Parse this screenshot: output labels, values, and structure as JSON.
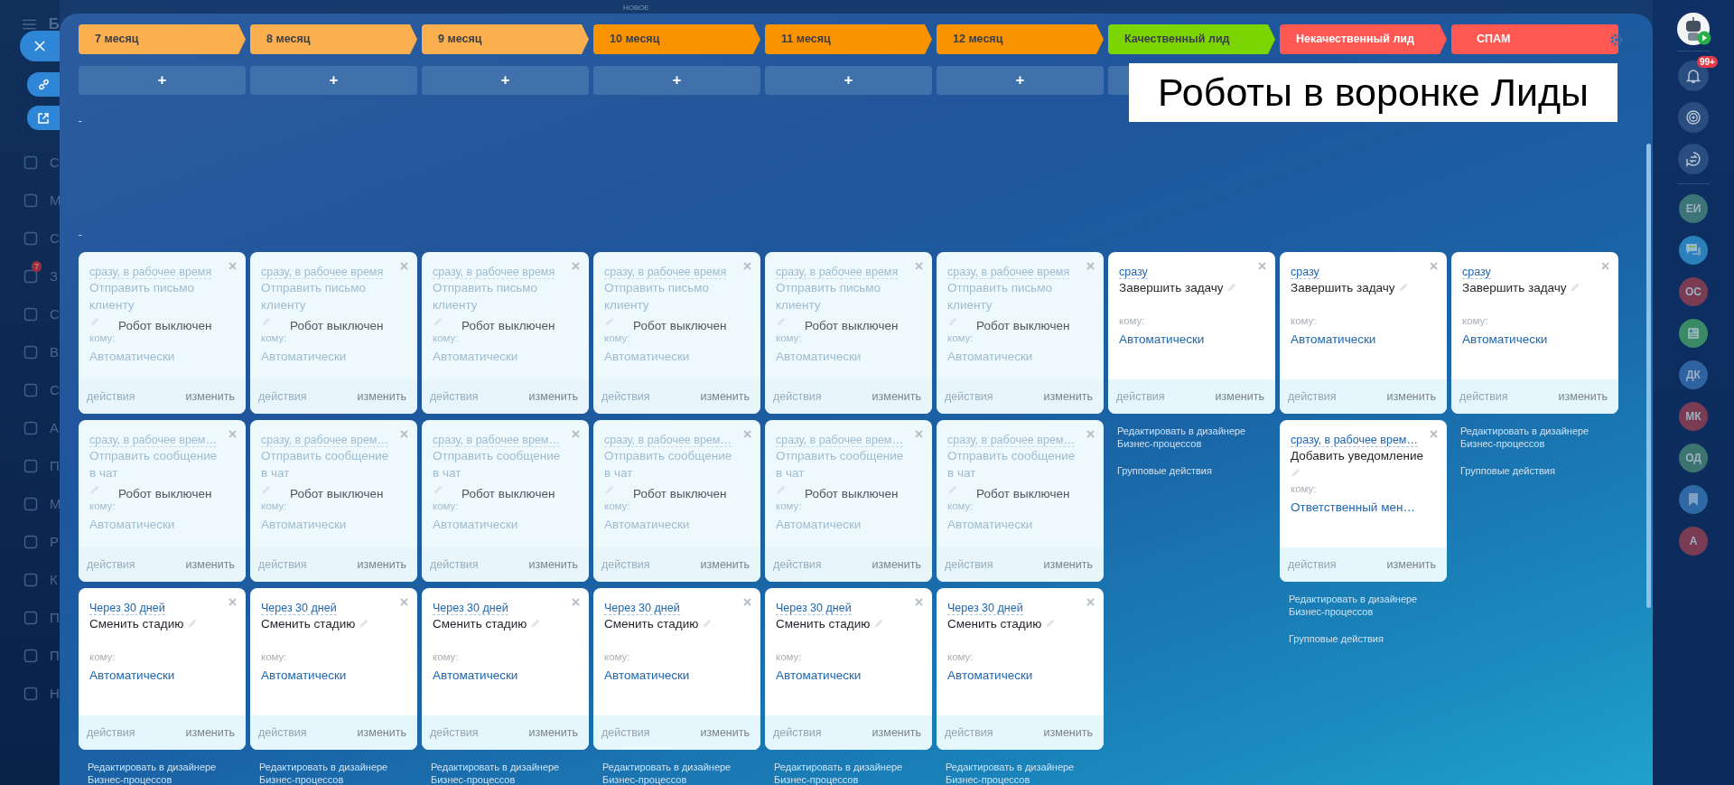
{
  "top_bar": {
    "label": "НОВОЕ"
  },
  "left_nav": {
    "title": "Б",
    "items": [
      {
        "label": "С"
      },
      {
        "label": "М"
      },
      {
        "label": "С"
      },
      {
        "label": "З",
        "badge": "7"
      },
      {
        "label": "С"
      },
      {
        "label": "В"
      },
      {
        "label": "С"
      },
      {
        "label": "А"
      },
      {
        "label": "П"
      },
      {
        "label": "М"
      },
      {
        "label": "Р"
      },
      {
        "label": "К"
      },
      {
        "label": "П"
      },
      {
        "label": "П"
      },
      {
        "label": "Н"
      }
    ]
  },
  "floating_buttons": [
    {
      "kind": "close"
    },
    {
      "kind": "link"
    },
    {
      "kind": "external"
    }
  ],
  "stages": [
    {
      "label": "7 месяц",
      "color": "#fcaf4f"
    },
    {
      "label": "8 месяц",
      "color": "#fcaf4f"
    },
    {
      "label": "9 месяц",
      "color": "#fcaf4f"
    },
    {
      "label": "10 месяц",
      "color": "#fa9300"
    },
    {
      "label": "11 месяц",
      "color": "#fa9300"
    },
    {
      "label": "12 месяц",
      "color": "#fa9300"
    },
    {
      "label": "Качественный лид",
      "color": "#7bd500"
    },
    {
      "label": "Некачественный лид",
      "color": "#ff5752"
    },
    {
      "label": "СПАМ",
      "color": "#ff5752"
    }
  ],
  "add_buttons": [
    {
      "label": "+"
    },
    {
      "label": "+"
    },
    {
      "label": "+"
    },
    {
      "label": "+"
    },
    {
      "label": "+"
    },
    {
      "label": "+"
    },
    {
      "kind": "covered"
    }
  ],
  "dashes": [
    "-",
    "-"
  ],
  "columns": [
    {
      "cells": [
        {
          "kind": "robot",
          "trigger": "сразу, в рабочее время",
          "action": "Отправить письмо клиенту",
          "recipient_label": "кому:",
          "recipient": "Автоматически",
          "disabled": true,
          "overlay": "Робот выключен",
          "footer_left": "действия",
          "footer_right": "изменить"
        },
        {
          "kind": "robot",
          "trigger": "сразу, в рабочее врем…",
          "action": "Отправить сообщение в чат",
          "recipient_label": "кому:",
          "recipient": "Автоматически",
          "disabled": true,
          "overlay": "Робот выключен",
          "footer_left": "действия",
          "footer_right": "изменить"
        },
        {
          "kind": "robot",
          "trigger": "Через 30 дней",
          "action": "Сменить стадию",
          "recipient_label": "кому:",
          "recipient": "Автоматически",
          "disabled": false,
          "footer_left": "действия",
          "footer_right": "изменить"
        },
        {
          "kind": "links",
          "edit": "Редактировать в дизайнере Бизнес-процессов"
        }
      ]
    },
    {
      "cells": [
        {
          "kind": "robot",
          "trigger": "сразу, в рабочее время",
          "action": "Отправить письмо клиенту",
          "recipient_label": "кому:",
          "recipient": "Автоматически",
          "disabled": true,
          "overlay": "Робот выключен",
          "footer_left": "действия",
          "footer_right": "изменить"
        },
        {
          "kind": "robot",
          "trigger": "сразу, в рабочее врем…",
          "action": "Отправить сообщение в чат",
          "recipient_label": "кому:",
          "recipient": "Автоматически",
          "disabled": true,
          "overlay": "Робот выключен",
          "footer_left": "действия",
          "footer_right": "изменить"
        },
        {
          "kind": "robot",
          "trigger": "Через 30 дней",
          "action": "Сменить стадию",
          "recipient_label": "кому:",
          "recipient": "Автоматически",
          "disabled": false,
          "footer_left": "действия",
          "footer_right": "изменить"
        },
        {
          "kind": "links",
          "edit": "Редактировать в дизайнере Бизнес-процессов"
        }
      ]
    },
    {
      "cells": [
        {
          "kind": "robot",
          "trigger": "сразу, в рабочее время",
          "action": "Отправить письмо клиенту",
          "recipient_label": "кому:",
          "recipient": "Автоматически",
          "disabled": true,
          "overlay": "Робот выключен",
          "footer_left": "действия",
          "footer_right": "изменить"
        },
        {
          "kind": "robot",
          "trigger": "сразу, в рабочее врем…",
          "action": "Отправить сообщение в чат",
          "recipient_label": "кому:",
          "recipient": "Автоматически",
          "disabled": true,
          "overlay": "Робот выключен",
          "footer_left": "действия",
          "footer_right": "изменить"
        },
        {
          "kind": "robot",
          "trigger": "Через 30 дней",
          "action": "Сменить стадию",
          "recipient_label": "кому:",
          "recipient": "Автоматически",
          "disabled": false,
          "footer_left": "действия",
          "footer_right": "изменить"
        },
        {
          "kind": "links",
          "edit": "Редактировать в дизайнере Бизнес-процессов"
        }
      ]
    },
    {
      "cells": [
        {
          "kind": "robot",
          "trigger": "сразу, в рабочее время",
          "action": "Отправить письмо клиенту",
          "recipient_label": "кому:",
          "recipient": "Автоматически",
          "disabled": true,
          "overlay": "Робот выключен",
          "footer_left": "действия",
          "footer_right": "изменить"
        },
        {
          "kind": "robot",
          "trigger": "сразу, в рабочее врем…",
          "action": "Отправить сообщение в чат",
          "recipient_label": "кому:",
          "recipient": "Автоматически",
          "disabled": true,
          "overlay": "Робот выключен",
          "footer_left": "действия",
          "footer_right": "изменить"
        },
        {
          "kind": "robot",
          "trigger": "Через 30 дней",
          "action": "Сменить стадию",
          "recipient_label": "кому:",
          "recipient": "Автоматически",
          "disabled": false,
          "footer_left": "действия",
          "footer_right": "изменить"
        },
        {
          "kind": "links",
          "edit": "Редактировать в дизайнере Бизнес-процессов"
        }
      ]
    },
    {
      "cells": [
        {
          "kind": "robot",
          "trigger": "сразу, в рабочее время",
          "action": "Отправить письмо клиенту",
          "recipient_label": "кому:",
          "recipient": "Автоматически",
          "disabled": true,
          "overlay": "Робот выключен",
          "footer_left": "действия",
          "footer_right": "изменить"
        },
        {
          "kind": "robot",
          "trigger": "сразу, в рабочее врем…",
          "action": "Отправить сообщение в чат",
          "recipient_label": "кому:",
          "recipient": "Автоматически",
          "disabled": true,
          "overlay": "Робот выключен",
          "footer_left": "действия",
          "footer_right": "изменить"
        },
        {
          "kind": "robot",
          "trigger": "Через 30 дней",
          "action": "Сменить стадию",
          "recipient_label": "кому:",
          "recipient": "Автоматически",
          "disabled": false,
          "footer_left": "действия",
          "footer_right": "изменить"
        },
        {
          "kind": "links",
          "edit": "Редактировать в дизайнере Бизнес-процессов"
        }
      ]
    },
    {
      "cells": [
        {
          "kind": "robot",
          "trigger": "сразу, в рабочее время",
          "action": "Отправить письмо клиенту",
          "recipient_label": "кому:",
          "recipient": "Автоматически",
          "disabled": true,
          "overlay": "Робот выключен",
          "footer_left": "действия",
          "footer_right": "изменить"
        },
        {
          "kind": "robot",
          "trigger": "сразу, в рабочее врем…",
          "action": "Отправить сообщение в чат",
          "recipient_label": "кому:",
          "recipient": "Автоматически",
          "disabled": true,
          "overlay": "Робот выключен",
          "footer_left": "действия",
          "footer_right": "изменить"
        },
        {
          "kind": "robot",
          "trigger": "Через 30 дней",
          "action": "Сменить стадию",
          "recipient_label": "кому:",
          "recipient": "Автоматически",
          "disabled": false,
          "footer_left": "действия",
          "footer_right": "изменить"
        },
        {
          "kind": "links",
          "edit": "Редактировать в дизайнере Бизнес-процессов"
        }
      ]
    },
    {
      "cells": [
        {
          "kind": "robot",
          "trigger": "сразу",
          "action": "Завершить задачу",
          "recipient_label": "кому:",
          "recipient": "Автоматически",
          "disabled": false,
          "footer_left": "действия",
          "footer_right": "изменить"
        },
        {
          "kind": "links",
          "edit": "Редактировать в дизайнере Бизнес-процессов",
          "group": "Групповые действия"
        }
      ]
    },
    {
      "cells": [
        {
          "kind": "robot",
          "trigger": "сразу",
          "action": "Завершить задачу",
          "recipient_label": "кому:",
          "recipient": "Автоматически",
          "disabled": false,
          "footer_left": "действия",
          "footer_right": "изменить"
        },
        {
          "kind": "robot",
          "trigger": "сразу, в рабочее врем…",
          "action": "Добавить уведомление",
          "recipient_label": "кому:",
          "recipient": "Ответственный мен…",
          "disabled": false,
          "footer_left": "действия",
          "footer_right": "изменить"
        },
        {
          "kind": "links",
          "edit": "Редактировать в дизайнере Бизнес-процессов",
          "group": "Групповые действия"
        }
      ]
    },
    {
      "cells": [
        {
          "kind": "robot",
          "trigger": "сразу",
          "action": "Завершить задачу",
          "recipient_label": "кому:",
          "recipient": "Автоматически",
          "disabled": false,
          "footer_left": "действия",
          "footer_right": "изменить"
        },
        {
          "kind": "links",
          "edit": "Редактировать в дизайнере Бизнес-процессов",
          "group": "Групповые действия"
        }
      ]
    }
  ],
  "caption": "Роботы в воронке Лиды",
  "right_bar": {
    "items": [
      {
        "kind": "robot-avatar"
      },
      {
        "kind": "divider"
      },
      {
        "kind": "bell",
        "badge": "99+"
      },
      {
        "kind": "spiral"
      },
      {
        "kind": "swap"
      },
      {
        "kind": "divider"
      },
      {
        "kind": "initials",
        "label": "ЕИ",
        "color": "#3c7478"
      },
      {
        "kind": "chat",
        "color": "#2b7fbb"
      },
      {
        "kind": "initials",
        "label": "ОС",
        "color": "#7a3c52"
      },
      {
        "kind": "news",
        "color": "#3a8a68"
      },
      {
        "kind": "initials",
        "label": "ДК",
        "color": "#2e62a0"
      },
      {
        "kind": "initials",
        "label": "МК",
        "color": "#7a3c52"
      },
      {
        "kind": "initials",
        "label": "ОД",
        "color": "#3c7470"
      },
      {
        "kind": "bookmark",
        "color": "#2e68a5"
      },
      {
        "kind": "initials",
        "label": "А",
        "color": "#7a3c52"
      }
    ]
  }
}
